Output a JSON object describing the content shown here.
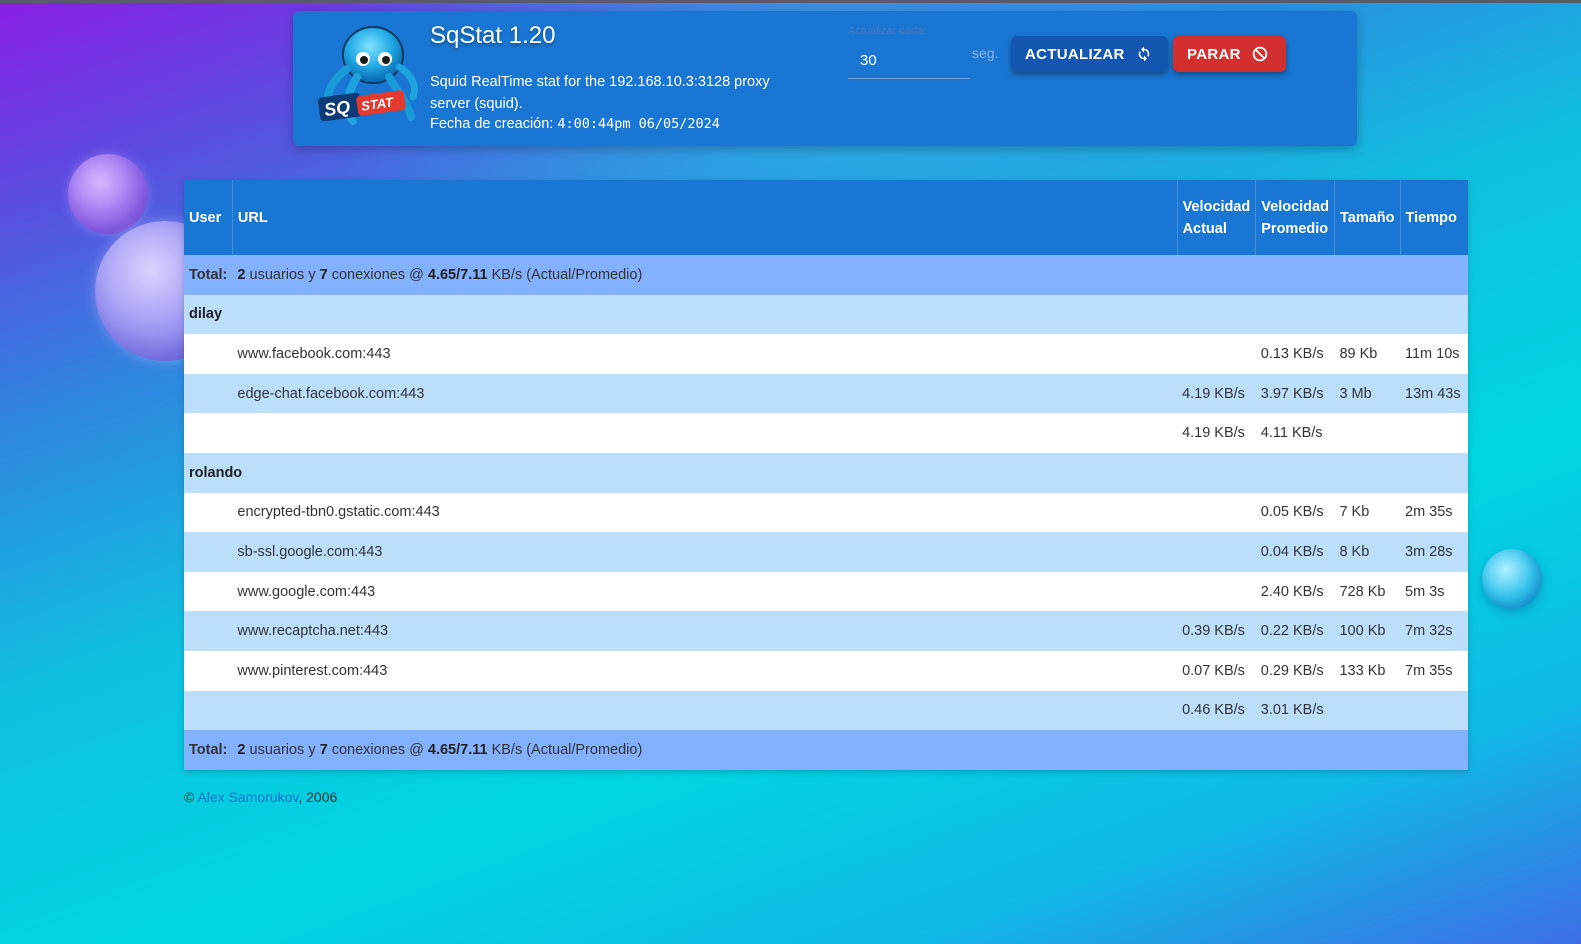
{
  "app": {
    "title": "SqStat 1.20",
    "description": "Squid RealTime stat for the 192.168.10.3:3128 proxy server (squid).",
    "date_label": "Fecha de creación:",
    "date_value": "4:00:44pm 06/05/2024"
  },
  "refresh": {
    "label": "Actualizar cada:",
    "value": "30",
    "unit": "seg.",
    "update_button": "ACTUALIZAR",
    "stop_button": "PARAR"
  },
  "table": {
    "headers": {
      "user": "User",
      "url": "URL",
      "current_speed_1": "Velocidad",
      "current_speed_2": "Actual",
      "avg_speed_1": "Velocidad",
      "avg_speed_2": "Promedio",
      "size": "Tamaño",
      "time": "Tiempo"
    },
    "total": {
      "label": "Total:",
      "users": "2",
      "users_text": "usuarios y",
      "connections": "7",
      "connections_text": "conexiones @",
      "speeds": "4.65/7.11",
      "speeds_text": "KB/s (Actual/Promedio)"
    },
    "groups": [
      {
        "user": "dilay",
        "rows": [
          {
            "url": "www.facebook.com:443",
            "current": "",
            "average": "0.13 KB/s",
            "size": "89 Kb",
            "time": "11m 10s"
          },
          {
            "url": "edge-chat.facebook.com:443",
            "current": "4.19 KB/s",
            "average": "3.97 KB/s",
            "size": "3 Mb",
            "time": "13m 43s"
          }
        ],
        "subtotal": {
          "current": "4.19 KB/s",
          "average": "4.11 KB/s"
        }
      },
      {
        "user": "rolando",
        "rows": [
          {
            "url": "encrypted-tbn0.gstatic.com:443",
            "current": "",
            "average": "0.05 KB/s",
            "size": "7 Kb",
            "time": "2m 35s"
          },
          {
            "url": "sb-ssl.google.com:443",
            "current": "",
            "average": "0.04 KB/s",
            "size": "8 Kb",
            "time": "3m 28s"
          },
          {
            "url": "www.google.com:443",
            "current": "",
            "average": "2.40 KB/s",
            "size": "728 Kb",
            "time": "5m 3s"
          },
          {
            "url": "www.recaptcha.net:443",
            "current": "0.39 KB/s",
            "average": "0.22 KB/s",
            "size": "100 Kb",
            "time": "7m 32s"
          },
          {
            "url": "www.pinterest.com:443",
            "current": "0.07 KB/s",
            "average": "0.29 KB/s",
            "size": "133 Kb",
            "time": "7m 35s"
          }
        ],
        "subtotal": {
          "current": "0.46 KB/s",
          "average": "3.01 KB/s"
        }
      }
    ]
  },
  "footer": {
    "copyright": "©",
    "author": "Alex Samorukov",
    "year": ", 2006"
  },
  "logo": {
    "text_sq": "SQ",
    "text_stat": "STAT"
  },
  "colors": {
    "header_bg": "#1976d2",
    "total_row": "#82b1ff",
    "light_row": "#bbdefb",
    "update_button": "#1457b3",
    "stop_button": "#d32f2f"
  }
}
